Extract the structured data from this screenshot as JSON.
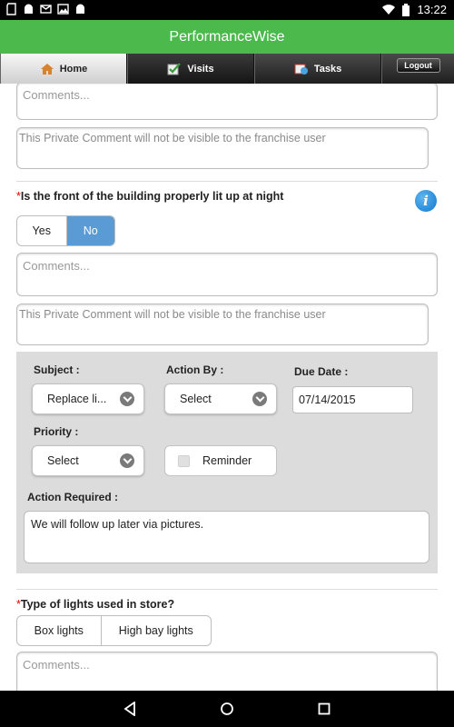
{
  "status_bar": {
    "time": "13:22"
  },
  "app": {
    "title": "PerformanceWise"
  },
  "tabs": {
    "home": "Home",
    "visits": "Visits",
    "tasks": "Tasks",
    "logout": "Logout"
  },
  "colors": {
    "appbar": "#4cb94c",
    "selected_segment": "#5a9bd5",
    "required": "#dd0000"
  },
  "top_block": {
    "comments_placeholder": "Comments...",
    "private_placeholder": "This Private Comment will not be visible to the franchise user"
  },
  "question1": {
    "required_mark": "*",
    "text": "Is the front of the building properly lit up at night",
    "options": [
      "Yes",
      "No"
    ],
    "selected": "No",
    "comments_placeholder": "Comments...",
    "private_placeholder": "This Private Comment will not be visible to the franchise user",
    "action_panel": {
      "subject_label": "Subject :",
      "subject_value": "Replace li...",
      "action_by_label": "Action By :",
      "action_by_value": "Select",
      "due_date_label": "Due Date :",
      "due_date_value": "07/14/2015",
      "priority_label": "Priority :",
      "priority_value": "Select",
      "reminder_label": "Reminder",
      "reminder_checked": false,
      "action_required_label": "Action Required :",
      "action_required_value": "We will follow up later via pictures."
    }
  },
  "question2": {
    "required_mark": "*",
    "text": "Type of lights used in store?",
    "options": [
      "Box lights",
      "High bay lights"
    ],
    "comments_placeholder": "Comments..."
  },
  "icons": {
    "home_tab": "home-icon",
    "visits_tab": "checkbox-icon",
    "tasks_tab": "calendar-clock-icon",
    "info": "info-icon",
    "nav_back": "back-icon",
    "nav_home": "home-circle-icon",
    "nav_recents": "recents-icon"
  }
}
